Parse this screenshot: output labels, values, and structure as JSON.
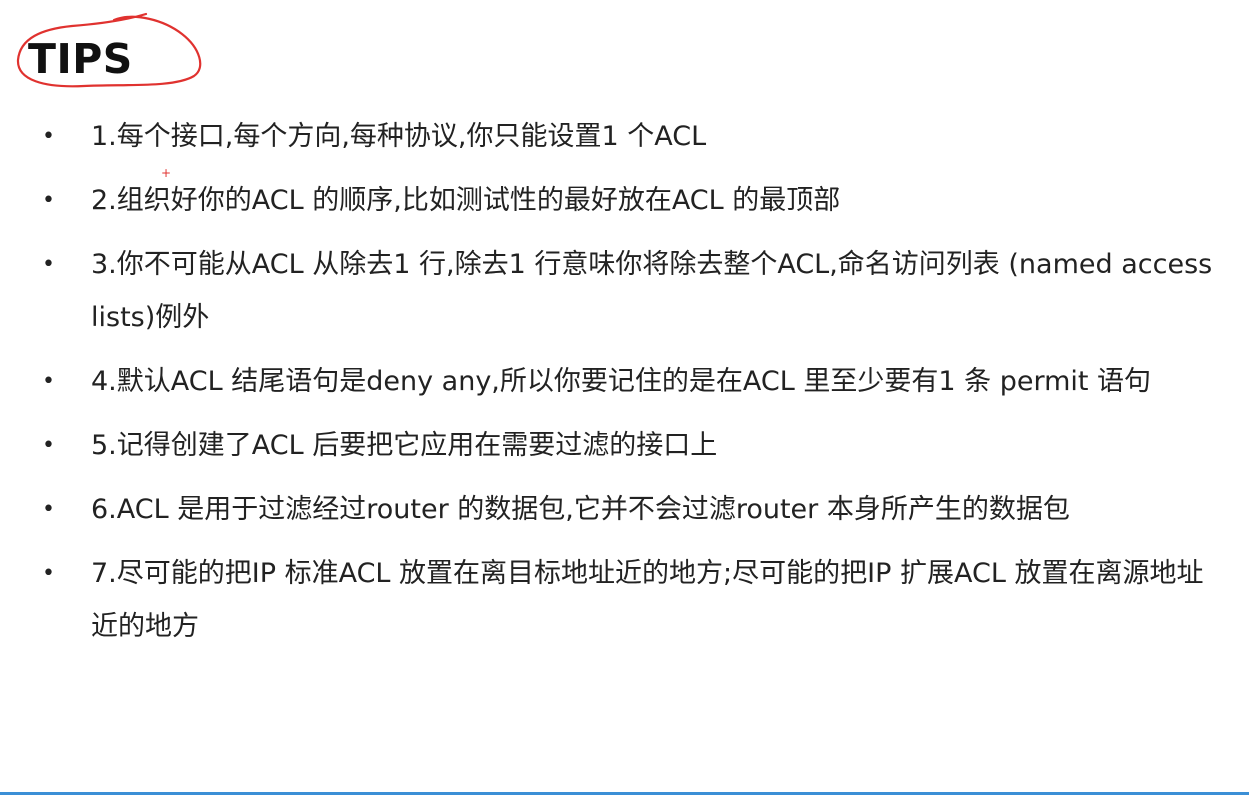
{
  "title": "TIPS",
  "colors": {
    "annotation": "#e0322f",
    "text": "#222222",
    "rule": "#3b8fd6"
  },
  "tips": [
    "1.每个接口,每个方向,每种协议,你只能设置1 个ACL",
    "2.组织好你的ACL 的顺序,比如测试性的最好放在ACL 的最顶部",
    "3.你不可能从ACL 从除去1 行,除去1 行意味你将除去整个ACL,命名访问列表 (named access lists)例外",
    "4.默认ACL 结尾语句是deny any,所以你要记住的是在ACL 里至少要有1 条 permit 语句",
    "5.记得创建了ACL 后要把它应用在需要过滤的接口上",
    "6.ACL 是用于过滤经过router 的数据包,它并不会过滤router 本身所产生的数据包",
    "7.尽可能的把IP 标准ACL 放置在离目标地址近的地方;尽可能的把IP 扩展ACL 放置在离源地址近的地方"
  ]
}
